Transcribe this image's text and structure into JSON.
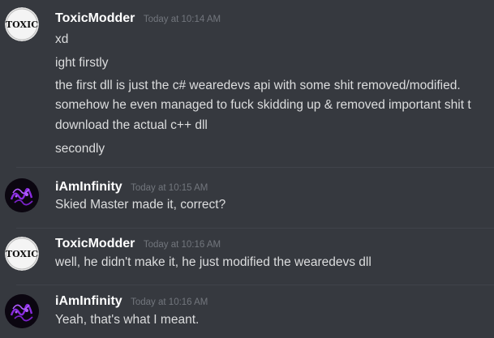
{
  "messages": [
    {
      "author": "ToxicModder",
      "timestamp": "Today at 10:14 AM",
      "avatar": "toxic-avatar",
      "avatar_text": "TOXIC",
      "lines": [
        "xd",
        "ight firstly",
        "the first dll is just the c# wearedevs api with some shit removed/modified.",
        "somehow he even managed to fuck skidding up & removed important shit t",
        "download the actual c++ dll",
        "secondly"
      ]
    },
    {
      "author": "iAmInfinity",
      "timestamp": "Today at 10:15 AM",
      "avatar": "purple-glyph-avatar",
      "lines": [
        "Skied Master made it, correct?"
      ]
    },
    {
      "author": "ToxicModder",
      "timestamp": "Today at 10:16 AM",
      "avatar": "toxic-avatar",
      "avatar_text": "TOXIC",
      "lines": [
        "well, he didn't make it, he just modified the wearedevs dll"
      ]
    },
    {
      "author": "iAmInfinity",
      "timestamp": "Today at 10:16 AM",
      "avatar": "purple-glyph-avatar",
      "lines": [
        "Yeah, that's what I meant."
      ]
    }
  ],
  "colors": {
    "background": "#36393f",
    "username": "#ffffff",
    "timestamp": "#72767d",
    "message_text": "#dcddde",
    "avatar_purple": "#8a2be2"
  }
}
